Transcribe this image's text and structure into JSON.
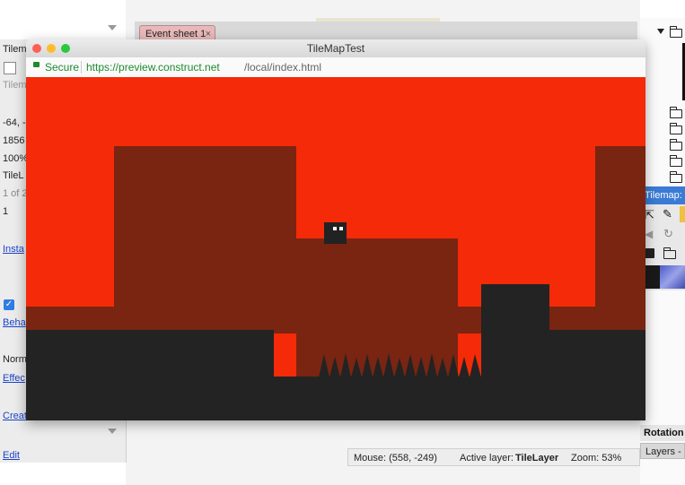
{
  "left_panel": {
    "rows": [
      {
        "id": "r1",
        "text": "Tilem"
      },
      {
        "id": "r2",
        "text": ""
      },
      {
        "id": "r3",
        "text": "Tilem"
      },
      {
        "id": "r4",
        "text": "-64, -"
      },
      {
        "id": "r5",
        "text": "1856"
      },
      {
        "id": "r6",
        "text": "100%"
      },
      {
        "id": "r7",
        "text": "TileL"
      },
      {
        "id": "r8",
        "text": "1 of 2"
      },
      {
        "id": "r9",
        "text": "1"
      }
    ],
    "links": {
      "instance": "Insta",
      "behaviors": "Beha",
      "effects": "Effec",
      "create": "Creat",
      "edit": "Edit"
    },
    "normal_text": "Norm"
  },
  "event_tab": {
    "label": "Event sheet 1",
    "close": "×"
  },
  "browser": {
    "title": "TileMapTest",
    "secure_label": "Secure",
    "url_host": "https://preview.construct.net",
    "url_path": "/local/index.html"
  },
  "status_bar": {
    "mouse_label": "Mouse: (558, -249)",
    "layer_prefix": "Active layer:",
    "layer_name": "TileLayer",
    "zoom_label": "Zoom: 53%"
  },
  "right_panel": {
    "tilemap_header": "Tilemap: T",
    "rotation_label": "Rotation",
    "layers_tab": "Layers -"
  },
  "colors": {
    "sky": "#f52a08",
    "wall": "#7a2412",
    "ground": "#232323",
    "accent_tab": "#e9b9b9"
  },
  "icons": [
    "checkbox-icon",
    "folder-icon",
    "lock-icon",
    "select-arrow-icon",
    "pencil-icon",
    "save-icon",
    "rotate-icon",
    "close-icon"
  ]
}
